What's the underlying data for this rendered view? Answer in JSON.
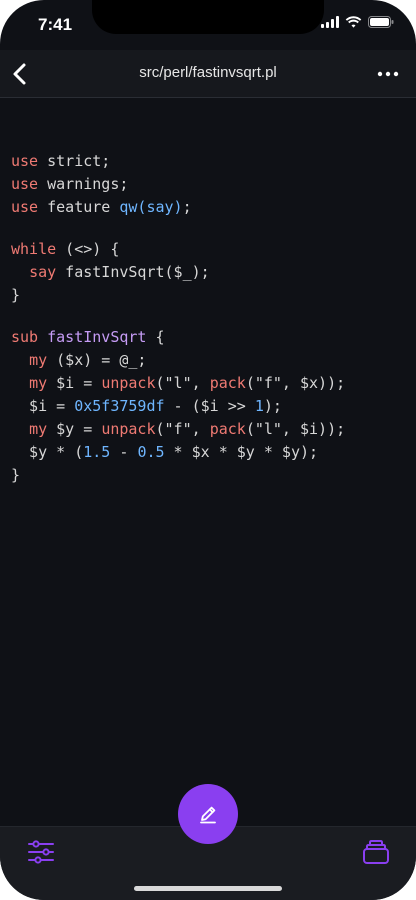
{
  "status_bar": {
    "time": "7:41"
  },
  "nav": {
    "title": "src/perl/fastinvsqrt.pl"
  },
  "colors": {
    "background": "#0f1116",
    "keyword": "#ef7a73",
    "function": "#c69cf5",
    "builtin": "#6fb6ff",
    "number": "#6fb6ff",
    "plain": "#d7d7d7",
    "accent": "#8a3ff0"
  },
  "icons": {
    "back": "chevron-left-icon",
    "more": "more-horizontal-icon",
    "compose": "pencil-icon",
    "settings": "sliders-icon",
    "library": "stack-icon"
  },
  "code": {
    "lines": [
      [
        {
          "t": "use",
          "c": "kw"
        },
        {
          "t": " strict;",
          "c": "plain"
        }
      ],
      [
        {
          "t": "use",
          "c": "kw"
        },
        {
          "t": " warnings;",
          "c": "plain"
        }
      ],
      [
        {
          "t": "use",
          "c": "kw"
        },
        {
          "t": " feature ",
          "c": "plain"
        },
        {
          "t": "qw(say)",
          "c": "bi"
        },
        {
          "t": ";",
          "c": "plain"
        }
      ],
      [],
      [
        {
          "t": "while",
          "c": "kw"
        },
        {
          "t": " (<>) {",
          "c": "plain"
        }
      ],
      [
        {
          "t": "  ",
          "c": "plain"
        },
        {
          "t": "say",
          "c": "kw"
        },
        {
          "t": " fastInvSqrt($_);",
          "c": "plain"
        }
      ],
      [
        {
          "t": "}",
          "c": "plain"
        }
      ],
      [],
      [
        {
          "t": "sub",
          "c": "kw"
        },
        {
          "t": " ",
          "c": "plain"
        },
        {
          "t": "fastInvSqrt",
          "c": "fn"
        },
        {
          "t": " {",
          "c": "plain"
        }
      ],
      [
        {
          "t": "  ",
          "c": "plain"
        },
        {
          "t": "my",
          "c": "kw"
        },
        {
          "t": " ($x) = @_;",
          "c": "plain"
        }
      ],
      [
        {
          "t": "  ",
          "c": "plain"
        },
        {
          "t": "my",
          "c": "kw"
        },
        {
          "t": " $i = ",
          "c": "plain"
        },
        {
          "t": "unpack",
          "c": "kw"
        },
        {
          "t": "(\"l\", ",
          "c": "plain"
        },
        {
          "t": "pack",
          "c": "kw"
        },
        {
          "t": "(\"f\", $x));",
          "c": "plain"
        }
      ],
      [
        {
          "t": "  $i = ",
          "c": "plain"
        },
        {
          "t": "0x5f3759df",
          "c": "num"
        },
        {
          "t": " - ($i >> ",
          "c": "plain"
        },
        {
          "t": "1",
          "c": "num"
        },
        {
          "t": ");",
          "c": "plain"
        }
      ],
      [
        {
          "t": "  ",
          "c": "plain"
        },
        {
          "t": "my",
          "c": "kw"
        },
        {
          "t": " $y = ",
          "c": "plain"
        },
        {
          "t": "unpack",
          "c": "kw"
        },
        {
          "t": "(\"f\", ",
          "c": "plain"
        },
        {
          "t": "pack",
          "c": "kw"
        },
        {
          "t": "(\"l\", $i));",
          "c": "plain"
        }
      ],
      [
        {
          "t": "  $y * (",
          "c": "plain"
        },
        {
          "t": "1.5",
          "c": "num"
        },
        {
          "t": " - ",
          "c": "plain"
        },
        {
          "t": "0.5",
          "c": "num"
        },
        {
          "t": " * $x * $y * $y);",
          "c": "plain"
        }
      ],
      [
        {
          "t": "}",
          "c": "plain"
        }
      ]
    ]
  }
}
